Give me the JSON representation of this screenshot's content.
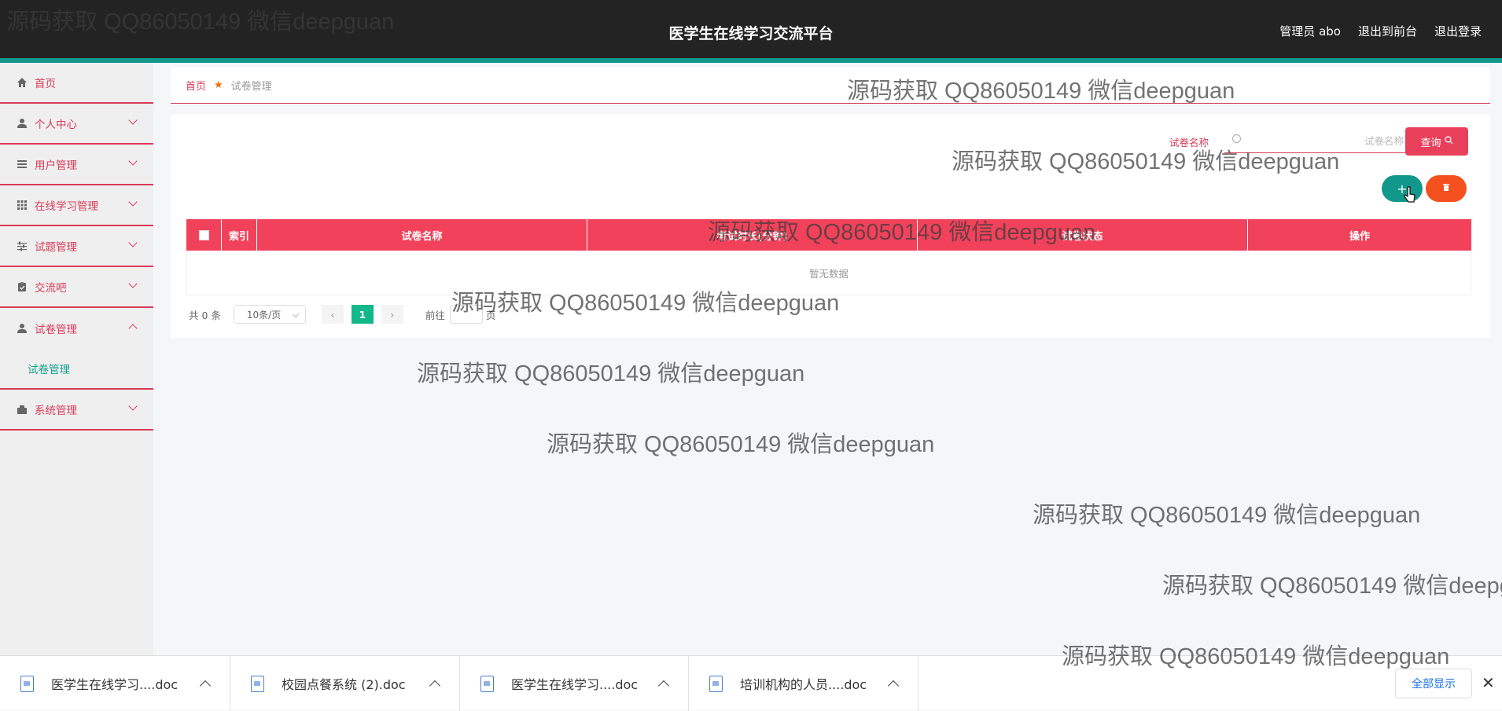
{
  "header": {
    "title": "医学生在线学习交流平台",
    "admin": "管理员 abo",
    "to_front": "退出到前台",
    "logout": "退出登录"
  },
  "sidebar": {
    "items": [
      {
        "label": "首页",
        "icon": "home-icon"
      },
      {
        "label": "个人中心",
        "icon": "user-icon"
      },
      {
        "label": "用户管理",
        "icon": "list-icon"
      },
      {
        "label": "在线学习管理",
        "icon": "grid-icon"
      },
      {
        "label": "试题管理",
        "icon": "sliders-icon"
      },
      {
        "label": "交流吧",
        "icon": "clipboard-icon"
      },
      {
        "label": "试卷管理",
        "icon": "user-icon"
      },
      {
        "label": "系统管理",
        "icon": "folder-icon"
      }
    ],
    "submenu": "试卷管理"
  },
  "breadcrumb": {
    "home": "首页",
    "current": "试卷管理"
  },
  "search": {
    "label": "试卷名称",
    "placeholder": "试卷名称",
    "button": "查询"
  },
  "table": {
    "columns": [
      "",
      "索引",
      "试卷名称",
      "考试时长(分钟)",
      "试卷状态",
      "操作"
    ],
    "empty": "暂无数据"
  },
  "pager": {
    "total": "共 0 条",
    "page_size": "10条/页",
    "current": "1",
    "goto": "前往",
    "page_unit": "页"
  },
  "watermark": "源码获取 QQ86050149 微信deepguan",
  "downloads": {
    "items": [
      "医学生在线学习....doc",
      "校园点餐系统 (2).doc",
      "医学生在线学习....doc",
      "培训机构的人员....doc"
    ],
    "show_all": "全部显示"
  }
}
